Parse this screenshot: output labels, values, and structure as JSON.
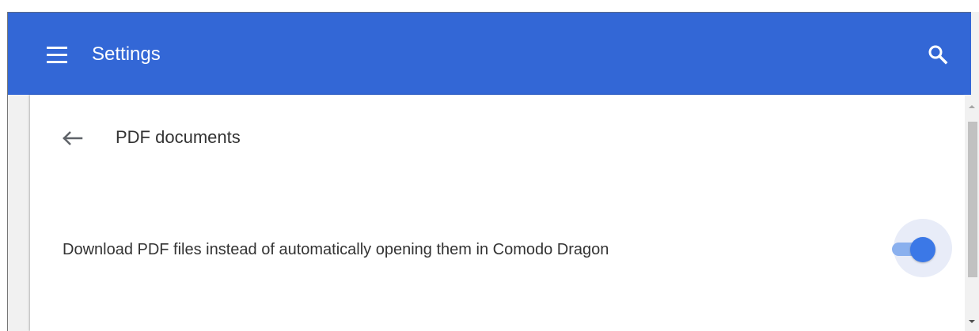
{
  "header": {
    "title": "Settings",
    "menu_icon": "hamburger-menu-icon",
    "search_icon": "search-icon",
    "background_color": "#3367d6"
  },
  "page": {
    "title": "PDF documents",
    "back_icon": "arrow-back-icon"
  },
  "setting": {
    "label": "Download PDF files instead of automatically opening them in Comodo Dragon",
    "enabled": true,
    "toggle_color": "#3b78e7"
  },
  "scrollbar": {
    "up_icon": "scroll-up-arrow-icon",
    "down_icon": "scroll-down-arrow-icon"
  }
}
